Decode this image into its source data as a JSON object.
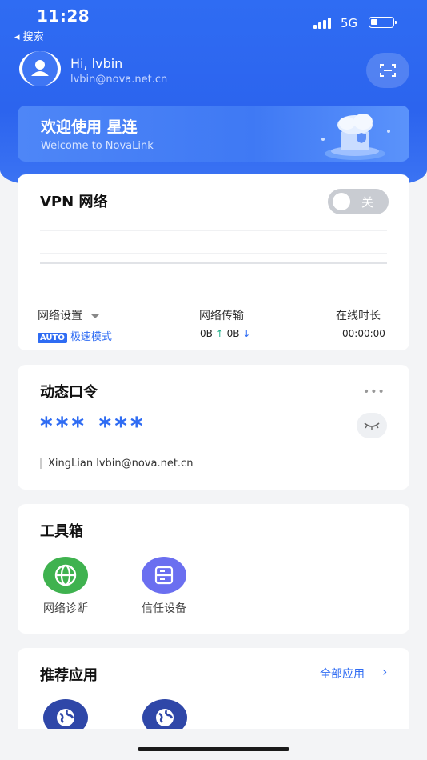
{
  "status_bar": {
    "time": "11:28",
    "back_label": "◂ 搜索",
    "network": "5G"
  },
  "header": {
    "greeting": "Hi, lvbin",
    "email": "lvbin@nova.net.cn"
  },
  "banner": {
    "title": "欢迎使用 星连",
    "subtitle": "Welcome to NovaLink"
  },
  "vpn": {
    "title": "VPN 网络",
    "toggle_label": "关",
    "toggle_on": false,
    "settings_label": "网络设置",
    "mode_badge": "AUTO",
    "mode": "极速模式",
    "transfer_label": "网络传输",
    "upload": "0B",
    "download": "0B",
    "online_label": "在线时长",
    "online_time": "00:00:00"
  },
  "otp": {
    "title": "动态口令",
    "more": "•••",
    "code": "*** ***",
    "account": "XingLian lvbin@nova.net.cn"
  },
  "toolbox": {
    "title": "工具箱",
    "tools": [
      {
        "label": "网络诊断",
        "icon": "globe-icon",
        "color": "#3fb24f"
      },
      {
        "label": "信任设备",
        "icon": "device-icon",
        "color": "#6b6ff0"
      }
    ]
  },
  "recommended": {
    "title": "推荐应用",
    "all_link": "全部应用",
    "arrow": "›",
    "apps": [
      {
        "icon": "app-globe-icon"
      },
      {
        "icon": "app-globe-icon"
      }
    ]
  },
  "colors": {
    "primary": "#2f6cf3",
    "green": "#3fb24f",
    "purple": "#6b6ff0",
    "app": "#2f47a8"
  }
}
